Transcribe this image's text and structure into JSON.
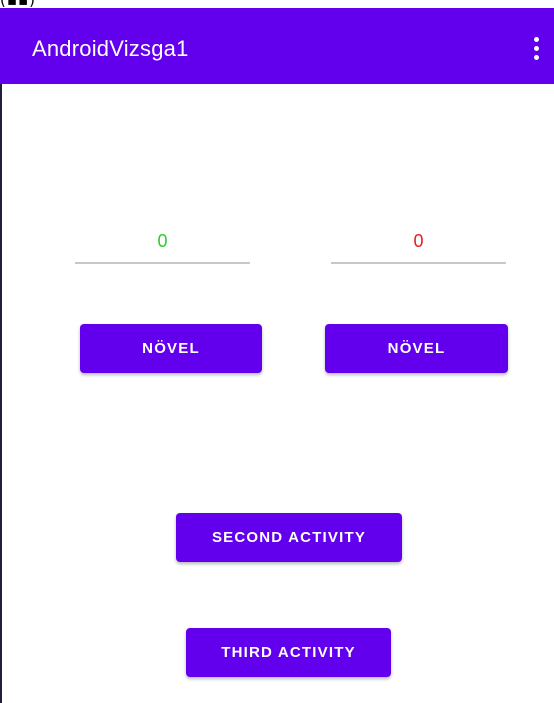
{
  "status_bar": {
    "glyphs": "(▪▪)"
  },
  "app_bar": {
    "title": "AndroidVizsga1",
    "overflow_icon": "more-vert-icon",
    "background_color": "#6200ee",
    "title_color": "#ffffff"
  },
  "counters": [
    {
      "value": "0",
      "color": "#2ecc2e"
    },
    {
      "value": "0",
      "color": "#e81c1c"
    }
  ],
  "buttons": {
    "increment_left": "NÖVEL",
    "increment_right": "NÖVEL",
    "second_activity": "SECOND ACTIVITY",
    "third_activity": "THIRD ACTIVITY"
  },
  "colors": {
    "accent": "#6200ee",
    "button_text": "#ffffff"
  }
}
